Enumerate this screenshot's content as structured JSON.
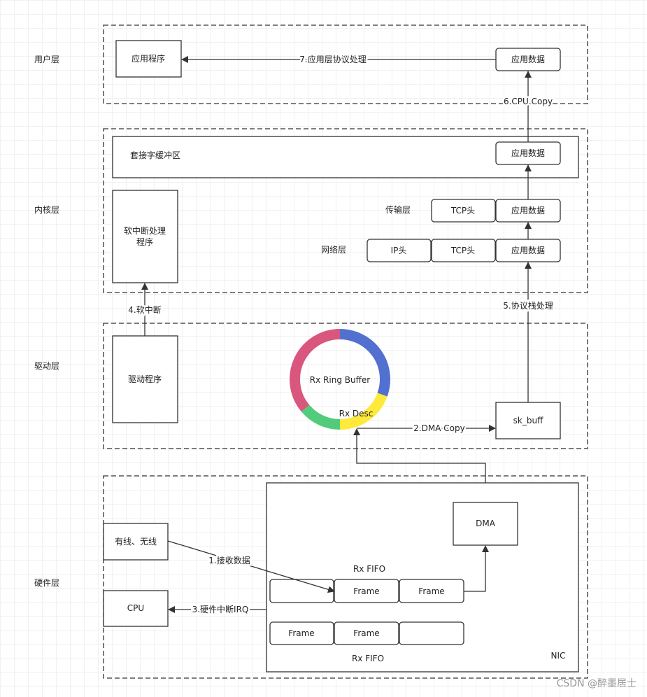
{
  "layers": {
    "user": "用户层",
    "kernel": "内核层",
    "driver": "驱动层",
    "hardware": "硬件层"
  },
  "user": {
    "app": "应用程序",
    "app_data": "应用数据",
    "step7": "7.应用层协议处理"
  },
  "kernel": {
    "socket_buffer": "套接字缓冲区",
    "socket_app_data": "应用数据",
    "step6": "6.CPU Copy",
    "transport_label": "传输层",
    "transport_tcp": "TCP头",
    "transport_data": "应用数据",
    "network_label": "网络层",
    "network_ip": "IP头",
    "network_tcp": "TCP头",
    "network_data": "应用数据",
    "softirq_handler": "软中断处理程序"
  },
  "driver": {
    "step4": "4.软中断",
    "step5": "5.协议栈处理",
    "driver_program": "驱动程序",
    "ring_buffer": "Rx Ring Buffer",
    "rx_desc": "Rx Desc",
    "step2": "2.DMA Copy",
    "sk_buff": "sk_buff",
    "ring_colors": {
      "blue": "#5170d0",
      "yellow": "#ffe93a",
      "green": "#52cc7c",
      "pink": "#d9577f"
    }
  },
  "hardware": {
    "wired_wireless": "有线、无线",
    "step1": "1.接收数据",
    "cpu": "CPU",
    "step3": "3.硬件中断IRQ",
    "dma": "DMA",
    "nic": "NIC",
    "rx_fifo_top": "Rx FIFO",
    "rx_fifo_bottom": "Rx FIFO",
    "frames_row1": [
      "",
      "Frame",
      "Frame"
    ],
    "frames_row2": [
      "Frame",
      "Frame",
      ""
    ]
  },
  "watermark": "CSDN @醉墨居士"
}
